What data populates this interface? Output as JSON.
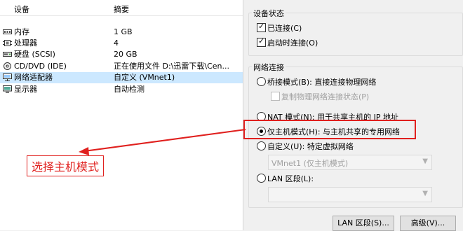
{
  "device_list": {
    "col_device": "设备",
    "col_summary": "摘要",
    "rows": [
      {
        "icon": "memory-icon",
        "name": "内存",
        "value": "1 GB"
      },
      {
        "icon": "processor-icon",
        "name": "处理器",
        "value": "4"
      },
      {
        "icon": "hard-disk-icon",
        "name": "硬盘 (SCSI)",
        "value": "20 GB"
      },
      {
        "icon": "cd-dvd-icon",
        "name": "CD/DVD (IDE)",
        "value": "正在使用文件 D:\\迅雷下载\\Cen..."
      },
      {
        "icon": "network-adapter-icon",
        "name": "网络适配器",
        "value": "自定义 (VMnet1)"
      },
      {
        "icon": "monitor-icon",
        "name": "显示器",
        "value": "自动检测"
      }
    ]
  },
  "device_status": {
    "title": "设备状态",
    "connected": {
      "label": "已连接(C)",
      "checked": true
    },
    "connect_at_power_on": {
      "label": "启动时连接(O)",
      "checked": true
    }
  },
  "network_connection": {
    "title": "网络连接",
    "bridged": {
      "label": "桥接模式(B): 直接连接物理网络",
      "selected": false
    },
    "replicate": {
      "label": "复制物理网络连接状态(P)",
      "checked": false
    },
    "nat": {
      "label": "NAT 模式(N): 用于共享主机的 IP 地址",
      "selected": false
    },
    "host_only": {
      "label": "仅主机模式(H): 与主机共享的专用网络",
      "selected": true
    },
    "custom": {
      "label": "自定义(U): 特定虚拟网络",
      "selected": false
    },
    "custom_select_value": "VMnet1 (仅主机模式)",
    "lan_segment": {
      "label": "LAN 区段(L):",
      "selected": false
    },
    "lan_select_value": ""
  },
  "buttons": {
    "lan_segments": "LAN 区段(S)...",
    "advanced": "高级(V)..."
  },
  "annotation": {
    "text": "选择主机模式",
    "color": "#e0201e"
  }
}
